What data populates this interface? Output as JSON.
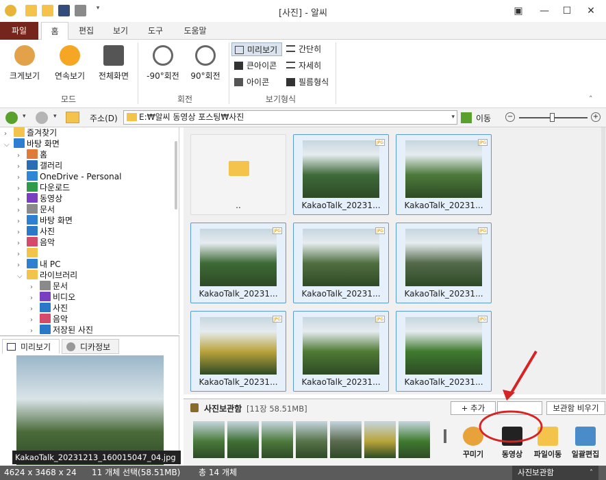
{
  "window": {
    "title": "[사진] - 알씨"
  },
  "tabs": [
    "파일",
    "홈",
    "편집",
    "보기",
    "도구",
    "도움말"
  ],
  "ribbon": {
    "mode": {
      "buttons": [
        "크게보기",
        "연속보기",
        "전체화면"
      ],
      "label": "모드"
    },
    "rotate": {
      "buttons": [
        "-90°회전",
        "90°회전"
      ],
      "label": "회전"
    },
    "view": {
      "buttons": [
        "미리보기",
        "간단히",
        "큰아이콘",
        "자세히",
        "아이콘",
        "필름형식"
      ],
      "label": "보기형식"
    }
  },
  "address": {
    "label": "주소(D)",
    "path": "E:₩알씨 동영상 포스팅₩사진",
    "go_label": "이동"
  },
  "tree": {
    "items": [
      {
        "label": "즐겨찾기",
        "level": 0,
        "icon": "folder-icon"
      },
      {
        "label": "바탕 화면",
        "level": 0,
        "icon": "desktop-icon"
      },
      {
        "label": "홈",
        "level": 1,
        "icon": "home-icon"
      },
      {
        "label": "갤러리",
        "level": 1,
        "icon": "gallery-icon"
      },
      {
        "label": "OneDrive - Personal",
        "level": 1,
        "icon": "cloud-icon"
      },
      {
        "label": "다운로드",
        "level": 1,
        "icon": "download-icon"
      },
      {
        "label": "동영상",
        "level": 1,
        "icon": "video-icon"
      },
      {
        "label": "문서",
        "level": 1,
        "icon": "document-icon"
      },
      {
        "label": "바탕 화면",
        "level": 1,
        "icon": "desktop-icon"
      },
      {
        "label": "사진",
        "level": 1,
        "icon": "picture-icon"
      },
      {
        "label": "음악",
        "level": 1,
        "icon": "music-icon"
      },
      {
        "label": "",
        "level": 1,
        "icon": "folder-icon"
      },
      {
        "label": "내 PC",
        "level": 1,
        "icon": "pc-icon"
      },
      {
        "label": "라이브러리",
        "level": 1,
        "icon": "folder-icon"
      },
      {
        "label": "문서",
        "level": 2,
        "icon": "document-icon"
      },
      {
        "label": "비디오",
        "level": 2,
        "icon": "video-icon"
      },
      {
        "label": "사진",
        "level": 2,
        "icon": "picture-icon"
      },
      {
        "label": "음악",
        "level": 2,
        "icon": "music-icon"
      },
      {
        "label": "저장된 사진",
        "level": 2,
        "icon": "picture-icon"
      }
    ]
  },
  "preview": {
    "tabs": [
      "미리보기",
      "디카정보"
    ],
    "caption": "KakaoTalk_20231213_160015047_04.jpg"
  },
  "gallery": {
    "parent_label": "..",
    "badge": "JPG",
    "items": [
      {
        "caption": "KakaoTalk_20231...",
        "tone": "#3f6a39"
      },
      {
        "caption": "KakaoTalk_20231...",
        "tone": "#4c7a3b"
      },
      {
        "caption": "KakaoTalk_20231...",
        "tone": "#3d6a36"
      },
      {
        "caption": "KakaoTalk_20231...",
        "tone": "#506f40"
      },
      {
        "caption": "KakaoTalk_20231...",
        "tone": "#546a4a"
      },
      {
        "caption": "KakaoTalk_20231...",
        "tone": "#b9a33a"
      },
      {
        "caption": "KakaoTalk_20231...",
        "tone": "#4f7a34"
      },
      {
        "caption": "KakaoTalk_20231...",
        "tone": "#3f7a2e"
      }
    ]
  },
  "storage": {
    "title": "사진보관함",
    "info": "[11장 58.51MB]",
    "add_label": "+ 추가",
    "clear_label": "보관함 비우기",
    "actions": [
      "꾸미기",
      "동영상",
      "파일이동",
      "일괄편집"
    ]
  },
  "status": {
    "dims": "4624 x 3468 x 24",
    "selected": "11 개체 선택(58.51MB)",
    "total": "총 14 개체",
    "storage_tab": "사진보관함"
  },
  "colors": {
    "file_tab": "#76251d",
    "accent": "#5a9ad8",
    "annotation": "#d62424"
  }
}
